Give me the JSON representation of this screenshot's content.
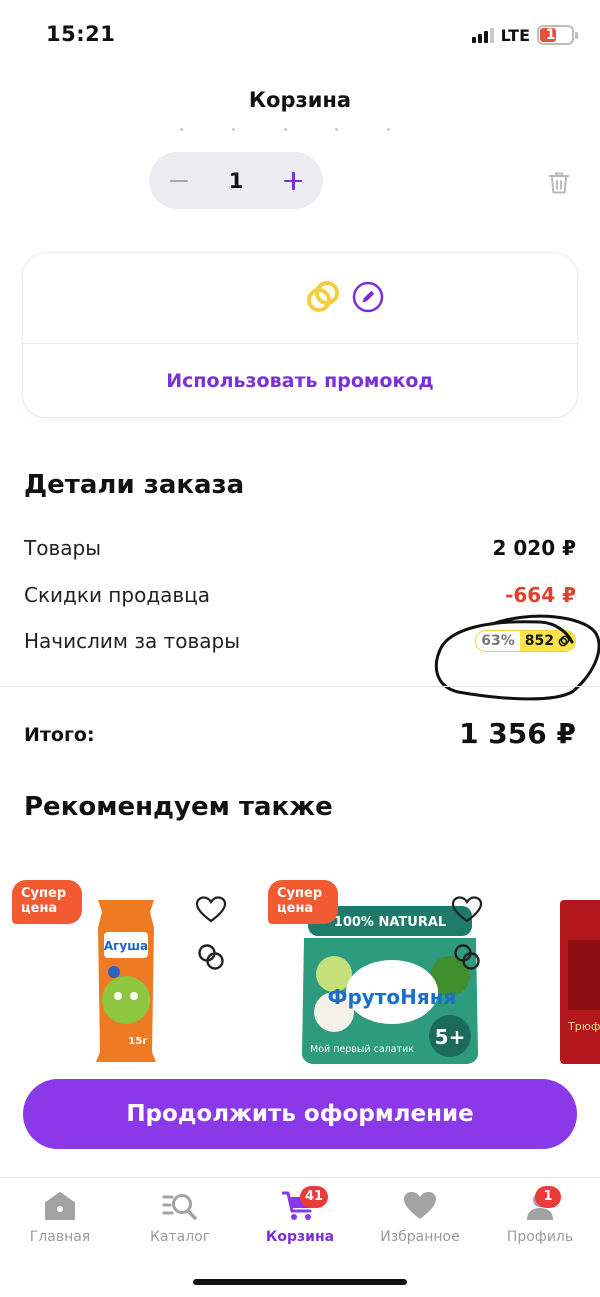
{
  "status_bar": {
    "time": "15:21",
    "network": "LTE",
    "battery": "11"
  },
  "header": {
    "title": "Корзина"
  },
  "cart_item": {
    "quantity": "1"
  },
  "promo": {
    "link_label": "Использовать промокод"
  },
  "order_details": {
    "title": "Детали заказа",
    "rows": [
      {
        "label": "Товары",
        "value": "2 020 ₽"
      },
      {
        "label": "Скидки продавца",
        "value": "-664 ₽"
      },
      {
        "label": "Начислим за товары",
        "bonus_percent": "63%",
        "bonus_amount": "852"
      }
    ],
    "total_label": "Итого:",
    "total_value": "1 356 ₽"
  },
  "recommendations": {
    "title": "Рекомендуем также",
    "items": [
      {
        "badge": "Супер цена",
        "package_text": "Агуша",
        "weight": "15г"
      },
      {
        "badge": "Супер цена",
        "package_text": "ФрутоНяня",
        "top_label": "100% NATURAL",
        "age_label": "5+",
        "bottom_text": "Мой первый салатик"
      },
      {
        "partial_text": "Трюф"
      }
    ]
  },
  "cta": {
    "label": "Продолжить оформление"
  },
  "bottom_nav": {
    "items": [
      {
        "label": "Главная",
        "icon": "home-icon"
      },
      {
        "label": "Каталог",
        "icon": "catalog-search-icon"
      },
      {
        "label": "Корзина",
        "icon": "cart-icon",
        "badge": "41",
        "active": true
      },
      {
        "label": "Избранное",
        "icon": "heart-icon"
      },
      {
        "label": "Профиль",
        "icon": "profile-icon",
        "badge": "1"
      }
    ]
  },
  "colors": {
    "accent": "#7b2fd8",
    "button": "#8a38e8",
    "discount": "#e0402c",
    "badge": "#f25a32",
    "bonus": "#fbe34a"
  }
}
